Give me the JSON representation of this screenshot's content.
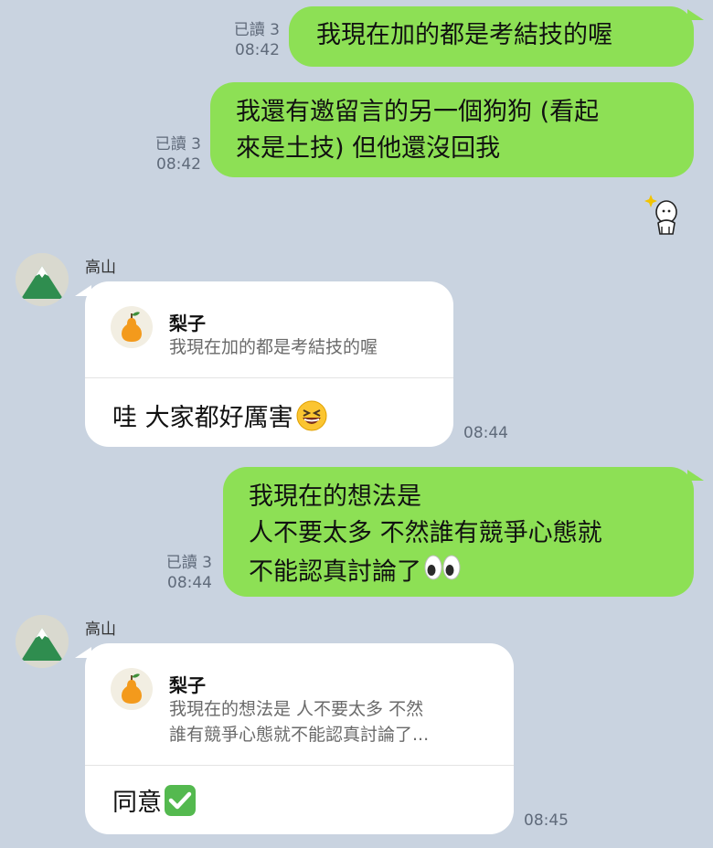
{
  "outgoing": [
    {
      "text": "我現在加的都是考結技的喔",
      "read": "已讀 3",
      "time": "08:42"
    },
    {
      "line1": "我還有邀留言的另一個狗狗 (看起",
      "line2": "來是土技) 但他還沒回我",
      "read": "已讀 3",
      "time": "08:42"
    },
    {
      "line1": "我現在的想法是",
      "line2": "人不要太多 不然誰有競爭心態就",
      "line3": "不能認真討論了",
      "read": "已讀 3",
      "time": "08:44"
    }
  ],
  "incoming": [
    {
      "sender": "高山",
      "reply_name": "梨子",
      "reply_line1": "我現在加的都是考結技的喔",
      "text": "哇 大家都好厲害",
      "time": "08:44"
    },
    {
      "sender": "高山",
      "reply_name": "梨子",
      "reply_line1": "我現在的想法是 人不要太多 不然",
      "reply_line2": "誰有競爭心態就不能認真討論了...",
      "text": "同意",
      "time": "08:45"
    }
  ],
  "colors": {
    "background": "#c9d3e0",
    "outgoing_bubble": "#8de055",
    "incoming_bubble": "#ffffff",
    "meta_text": "#5f6a7a",
    "check_green": "#54b94f"
  },
  "icons": {
    "avatar": "mountain-avatar-icon",
    "reply": "pear-icon",
    "sticker": "bunny-sticker-icon",
    "emoji1": "laughing-face-emoji",
    "emoji2": "eyes-emoji",
    "emoji3": "check-mark-emoji"
  }
}
